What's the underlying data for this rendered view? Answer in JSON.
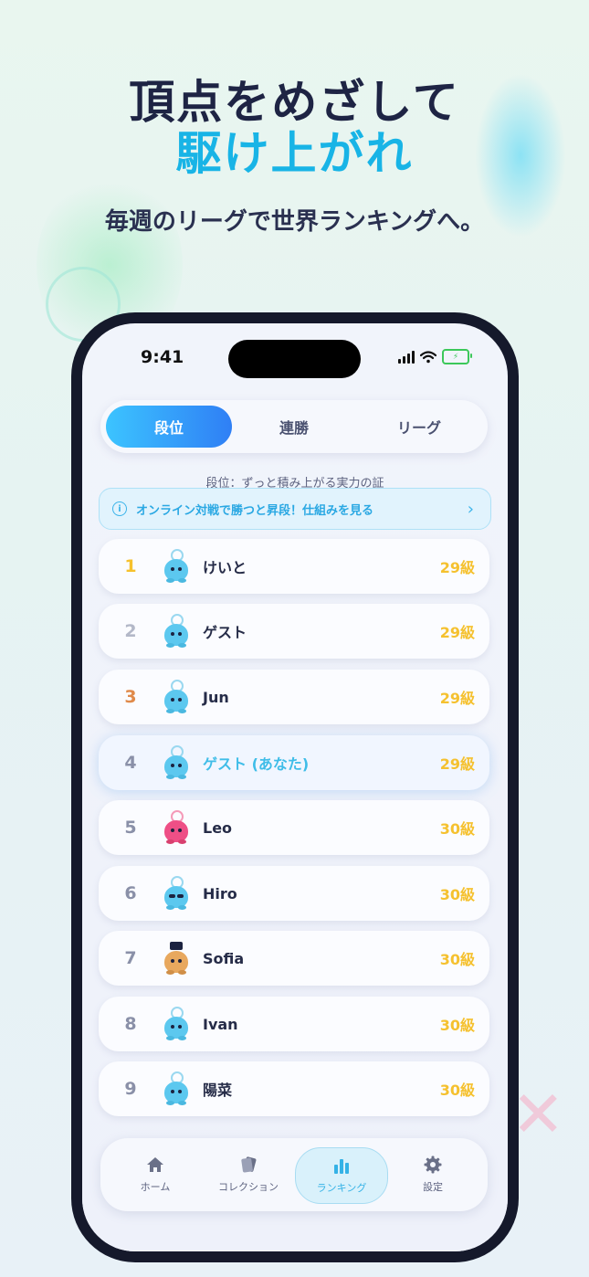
{
  "hero": {
    "title_line1": "頂点をめざして",
    "title_line2": "駆け上がれ",
    "subtitle": "毎週のリーグで世界ランキングへ。"
  },
  "status_bar": {
    "time": "9:41"
  },
  "tabs": [
    {
      "label": "段位",
      "active": true
    },
    {
      "label": "連勝",
      "active": false
    },
    {
      "label": "リーグ",
      "active": false
    }
  ],
  "caption": "段位：ずっと積み上がる実力の証",
  "info_banner": {
    "icon": "info-icon",
    "text": "オンライン対戦で勝つと昇段！仕組みを見る",
    "chevron": "›"
  },
  "leaderboard": [
    {
      "rank": "1",
      "name": "けいと",
      "score": "29級",
      "avatar": "blue-blob-crown"
    },
    {
      "rank": "2",
      "name": "ゲスト",
      "score": "29級",
      "avatar": "blue-blob-crown"
    },
    {
      "rank": "3",
      "name": "Jun",
      "score": "29級",
      "avatar": "blue-blob-crown"
    },
    {
      "rank": "4",
      "name": "ゲスト (あなた)",
      "score": "29級",
      "avatar": "blue-blob"
    },
    {
      "rank": "5",
      "name": "Leo",
      "score": "30級",
      "avatar": "pink-blob-x"
    },
    {
      "rank": "6",
      "name": "Hiro",
      "score": "30級",
      "avatar": "blue-blob-sunglasses"
    },
    {
      "rank": "7",
      "name": "Sofia",
      "score": "30級",
      "avatar": "bear-top-hat"
    },
    {
      "rank": "8",
      "name": "Ivan",
      "score": "30級",
      "avatar": "blue-blob"
    },
    {
      "rank": "9",
      "name": "陽菜",
      "score": "30級",
      "avatar": "blue-blob"
    }
  ],
  "bottom_nav": [
    {
      "label": "ホーム",
      "icon": "home-icon",
      "active": false
    },
    {
      "label": "コレクション",
      "icon": "cards-icon",
      "active": false
    },
    {
      "label": "ランキング",
      "icon": "bar-chart-icon",
      "active": true
    },
    {
      "label": "設定",
      "icon": "gear-icon",
      "active": false
    }
  ],
  "colors": {
    "accent_blue": "#18b4e6",
    "tab_gradient_start": "#3cc4ff",
    "tab_gradient_end": "#2f7ff5",
    "score_gold": "#f5c12f",
    "rank_gold": "#f6c12d",
    "rank_silver": "#b3b8c8",
    "rank_bronze": "#e08a4a",
    "me_highlight": "#3fbde8"
  }
}
